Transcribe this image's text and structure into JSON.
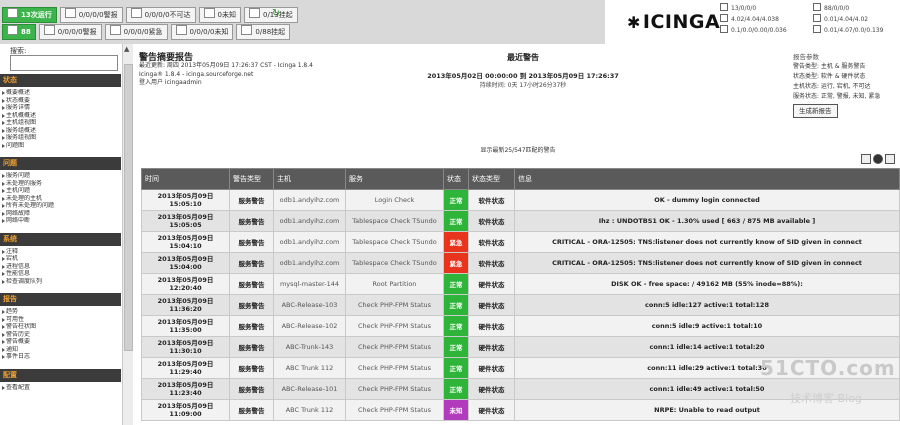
{
  "topbar": {
    "row1": [
      {
        "label": "13次运行",
        "style": "green"
      },
      {
        "label": "0/0/0/0警报"
      },
      {
        "label": "0/0/0/0不可达"
      },
      {
        "label": "0未知"
      },
      {
        "label": "0/13挂起"
      }
    ],
    "row2": [
      {
        "label": "88",
        "style": "green"
      },
      {
        "label": "0/0/0/0警报"
      },
      {
        "label": "0/0/0/0紧急"
      },
      {
        "label": "0/0/0/0未知"
      },
      {
        "label": "0/88挂起"
      }
    ],
    "mini_left": [
      "13/0/0/0",
      "4.02/4.04/4.038",
      "0.1/0.0/0.00/0.036"
    ],
    "mini_right": [
      "88/0/0/0",
      "0.01/4.04/4.02",
      "0.01/4.07/0.0/0.139"
    ],
    "logo_text": "ICINGA"
  },
  "sidebar": {
    "search_label": "搜索:",
    "sections": [
      {
        "title": "状态",
        "items": [
          "概要概述",
          "状态概要",
          "服务详情",
          "主机概概述",
          "主机组视图",
          "服务组概述",
          "服务组视图",
          "问题图"
        ]
      },
      {
        "title": "问题",
        "items": [
          "服务问题",
          "未处理的服务",
          "主机问题",
          "未处理的主机",
          "所有未处理的问题",
          "网络故障",
          "网络中断"
        ]
      },
      {
        "title": "系统",
        "items": [
          "注释",
          "宕机",
          "进程信息",
          "性能信息",
          "检查调度队列"
        ]
      },
      {
        "title": "报告",
        "items": [
          "趋势",
          "可用性",
          "警告柱状图",
          "警告历史",
          "警告概要",
          "通知",
          "事件日志"
        ]
      },
      {
        "title": "配置",
        "items": [
          "查看配置"
        ]
      }
    ]
  },
  "report": {
    "title": "警告摘要报告",
    "meta": [
      "最近更新: 周四 2013年05月09日 17:26:37 CST - Icinga 1.8.4",
      "Icinga® 1.8.4 - icinga.sourceforge.net",
      "登入用户 icingaadmin"
    ],
    "center_title": "最近警告",
    "range": "2013年05月02日 00:00:00 到 2013年05月09日 17:26:37",
    "duration": "持续时间: 0天 17小时26分37秒",
    "filter_title": "报告参数",
    "filters": [
      "警告类型: 主机 & 服务警告",
      "状态类型: 软件 & 硬件状态",
      "主机状态: 运行, 宕机, 不可达",
      "服务状态: 正常, 警报, 未知, 紧急"
    ],
    "update_button": "生成新报告",
    "showing": "显示最新25/547匹配的警告",
    "columns": [
      "时间",
      "警告类型",
      "主机",
      "服务",
      "状态",
      "状态类型",
      "信息"
    ],
    "rows": [
      {
        "time": "2013年05月09日 15:05:10",
        "type": "服务警告",
        "host": "odb1.andyihz.com",
        "service": "Login Check",
        "state": "正常",
        "state_color": "#2fb43a",
        "state_type": "软件状态",
        "info": "OK - dummy login connected"
      },
      {
        "time": "2013年05月09日 15:05:05",
        "type": "服务警告",
        "host": "odb1.andyihz.com",
        "service": "Tablespace Check TSundo",
        "state": "正常",
        "state_color": "#2fb43a",
        "state_type": "软件状态",
        "info": "Ihz : UNDOTBS1 OK - 1.30% used [ 663 / 875 MB available ]"
      },
      {
        "time": "2013年05月09日 15:04:10",
        "type": "服务警告",
        "host": "odb1.andyihz.com",
        "service": "Tablespace Check TSundo",
        "state": "紧急",
        "state_color": "#e8341c",
        "state_type": "软件状态",
        "info": "CRITICAL - ORA-12505: TNS:listener does not currently know of SID given in connect"
      },
      {
        "time": "2013年05月09日 15:04:00",
        "type": "服务警告",
        "host": "odb1.andyihz.com",
        "service": "Tablespace Check TSundo",
        "state": "紧急",
        "state_color": "#e8341c",
        "state_type": "软件状态",
        "info": "CRITICAL - ORA-12505: TNS:listener does not currently know of SID given in connect"
      },
      {
        "time": "2013年05月09日 12:20:40",
        "type": "服务警告",
        "host": "mysql-master-144",
        "service": "Root Partition",
        "state": "正常",
        "state_color": "#2fb43a",
        "state_type": "硬件状态",
        "info": "DISK OK - free space: / 49162 MB (55% inode=88%):"
      },
      {
        "time": "2013年05月09日 11:36:20",
        "type": "服务警告",
        "host": "ABC-Release-103",
        "service": "Check PHP-FPM Status",
        "state": "正常",
        "state_color": "#2fb43a",
        "state_type": "硬件状态",
        "info": "conn:5 idle:127 active:1 total:128"
      },
      {
        "time": "2013年05月09日 11:35:00",
        "type": "服务警告",
        "host": "ABC-Release-102",
        "service": "Check PHP-FPM Status",
        "state": "正常",
        "state_color": "#2fb43a",
        "state_type": "硬件状态",
        "info": "conn:5 idle:9 active:1 total:10"
      },
      {
        "time": "2013年05月09日 11:30:10",
        "type": "服务警告",
        "host": "ABC-Trunk-143",
        "service": "Check PHP-FPM Status",
        "state": "正常",
        "state_color": "#2fb43a",
        "state_type": "硬件状态",
        "info": "conn:1 idle:14 active:1 total:20"
      },
      {
        "time": "2013年05月09日 11:29:40",
        "type": "服务警告",
        "host": "ABC Trunk 112",
        "service": "Check PHP-FPM Status",
        "state": "正常",
        "state_color": "#2fb43a",
        "state_type": "硬件状态",
        "info": "conn:11 idle:29 active:1 total:30"
      },
      {
        "time": "2013年05月09日 11:23:40",
        "type": "服务警告",
        "host": "ABC-Release-101",
        "service": "Check PHP-FPM Status",
        "state": "正常",
        "state_color": "#2fb43a",
        "state_type": "硬件状态",
        "info": "conn:1 idle:49 active:1 total:50"
      },
      {
        "time": "2013年05月09日 11:09:00",
        "type": "服务警告",
        "host": "ABC Trunk 112",
        "service": "Check PHP-FPM Status",
        "state": "未知",
        "state_color": "#b23bbd",
        "state_type": "硬件状态",
        "info": "NRPE: Unable to read output"
      }
    ]
  },
  "watermark": {
    "main": "51CTO.com",
    "sub": "技术博客  Blog"
  }
}
